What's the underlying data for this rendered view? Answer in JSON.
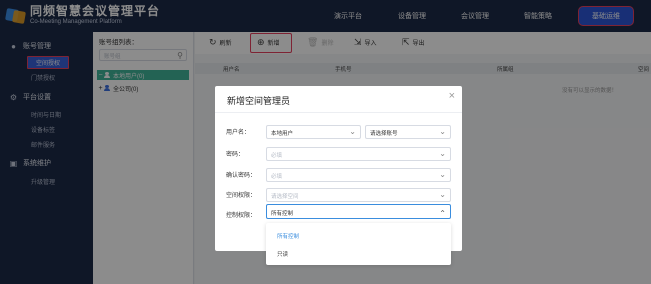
{
  "header": {
    "logo_title": "同频智慧会议管理平台",
    "logo_subtitle": "Co-Meeting Management Platform",
    "nav": [
      "演示平台",
      "设备管理",
      "会议管理",
      "智能策略",
      "基础运维"
    ],
    "active_nav": "基础运维"
  },
  "sidebar": {
    "groups": [
      {
        "label": "账号管理",
        "icon": "user-icon",
        "items": [
          "空间授权",
          "门禁授权"
        ]
      },
      {
        "label": "平台设置",
        "icon": "gear-icon",
        "items": [
          "时间与日期",
          "设备标签",
          "邮件服务"
        ]
      },
      {
        "label": "系统维护",
        "icon": "monitor-icon",
        "items": [
          "升级管理"
        ]
      }
    ],
    "active_item": "空间授权"
  },
  "group_panel": {
    "title": "账号组列表：",
    "search_placeholder": "账号组",
    "tree": [
      {
        "label": "本地用户(0)",
        "toggle": "−",
        "selected": true
      },
      {
        "label": "全公司(0)",
        "toggle": "+",
        "selected": false
      }
    ]
  },
  "toolbar": {
    "refresh": "刷新",
    "add": "新增",
    "delete": "删除",
    "import": "导入",
    "export": "导出"
  },
  "table": {
    "columns": [
      "用户名",
      "手机号",
      "所属组",
      "空间"
    ],
    "empty_text": "没有可以显示的数据！"
  },
  "dialog": {
    "title": "新增空间管理员",
    "close_icon": "close-icon",
    "fields": {
      "username_label": "用户名：",
      "username_source": "本地用户",
      "username_account": "请选择账号",
      "password_label": "密码：",
      "password_placeholder": "必填",
      "confirm_label": "确认密码：",
      "confirm_placeholder": "必填",
      "space_label": "空间权限：",
      "space_placeholder": "请选择空间",
      "control_label": "控制权限：",
      "control_value": "所有控制"
    },
    "control_options": [
      "所有控制",
      "只读"
    ],
    "control_selected": "所有控制"
  },
  "colors": {
    "dark_navy": "#1d2a47",
    "active_blue": "#2d57d8",
    "highlight_red": "#e5415f",
    "tree_selected": "#41b49a",
    "option_selected": "#3a8dde"
  }
}
